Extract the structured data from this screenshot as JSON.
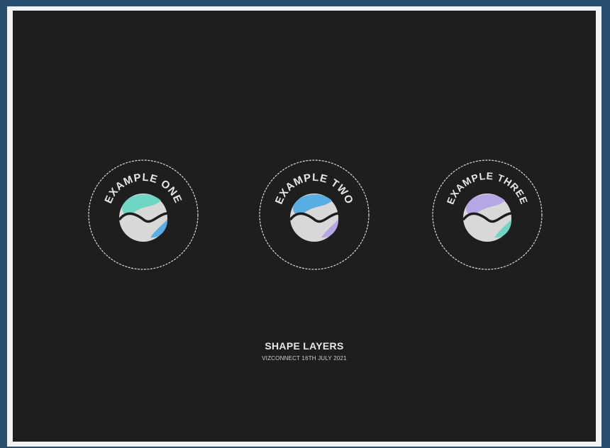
{
  "slide": {
    "title": "SHAPE LAYERS",
    "subtitle": "VIZCONNECT 16TH JULY 2021"
  },
  "badges": [
    {
      "label": "EXAMPLE ONE",
      "top_color": "#6fd6c4",
      "bottom_color": "#58aee3"
    },
    {
      "label": "EXAMPLE TWO",
      "top_color": "#58aee3",
      "bottom_color": "#b3a7e6"
    },
    {
      "label": "EXAMPLE THREE",
      "top_color": "#b3a7e6",
      "bottom_color": "#6fd6c4"
    }
  ],
  "colors": {
    "background": "#1e1e1e",
    "ring": "#d9d9d9",
    "ball": "#d8d8d8",
    "frame_border": "#2a4f6e"
  }
}
